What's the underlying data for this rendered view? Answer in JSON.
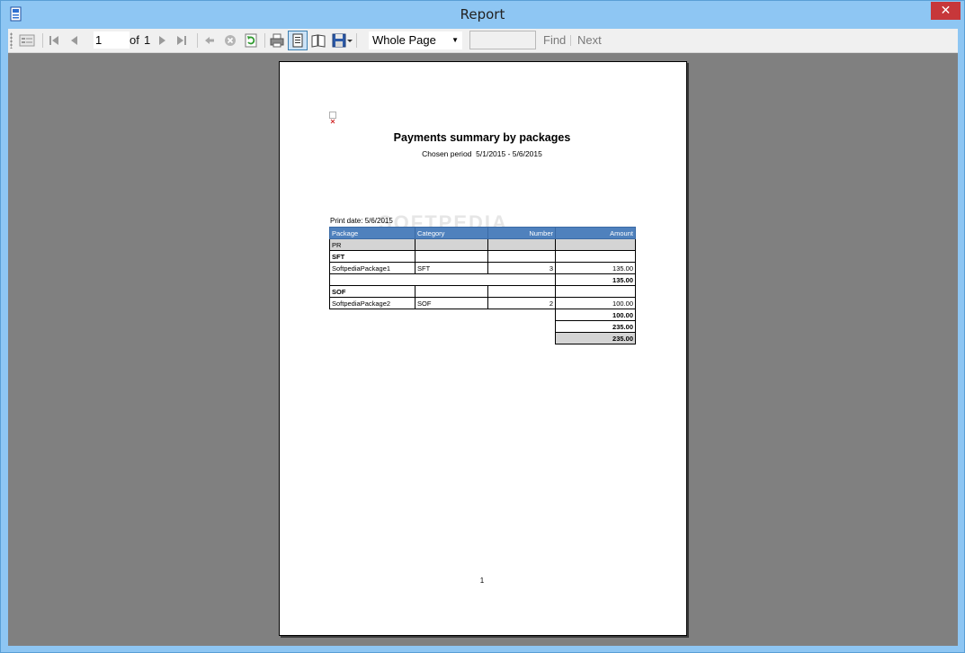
{
  "window": {
    "title": "Report",
    "close_glyph": "✕",
    "app_icon": "report-app-icon"
  },
  "toolbar": {
    "page_current": "1",
    "page_of_label": "of",
    "page_total": "1",
    "zoom_value": "Whole Page",
    "find_value": "",
    "find_label": "Find",
    "next_label": "Next",
    "icons": [
      "parameters-icon",
      "first-page-icon",
      "previous-page-icon",
      "next-page-icon",
      "last-page-icon",
      "back-icon",
      "stop-icon",
      "refresh-icon",
      "print-icon",
      "print-layout-icon",
      "page-setup-icon",
      "save-icon",
      "dropdown-arrow-icon"
    ]
  },
  "report": {
    "title": "Payments summary by packages",
    "period_label": "Chosen period",
    "period_value": "5/1/2015 - 5/6/2015",
    "print_date": "Print date: 5/6/2015",
    "watermark": "SOFTPEDIA",
    "header_color": "#4f81bd",
    "columns": [
      "Package",
      "Category",
      "Number",
      "Amount"
    ],
    "rows": [
      {
        "type": "group",
        "cells": [
          "PR",
          "",
          "",
          ""
        ]
      },
      {
        "type": "subgroup",
        "cells": [
          "SFT",
          "",
          "",
          ""
        ]
      },
      {
        "type": "detail",
        "cells": [
          "SoftpediaPackage1",
          "SFT",
          "3",
          "135.00"
        ]
      },
      {
        "type": "subtotal",
        "cells": [
          "",
          "",
          "",
          "135.00"
        ]
      },
      {
        "type": "subgroup",
        "cells": [
          "SOF",
          "",
          "",
          ""
        ]
      },
      {
        "type": "detail",
        "cells": [
          "SoftpediaPackage2",
          "SOF",
          "2",
          "100.00"
        ]
      },
      {
        "type": "subtotal",
        "cells": [
          "",
          "",
          "",
          "100.00"
        ]
      },
      {
        "type": "total",
        "cells": [
          "",
          "",
          "",
          "235.00"
        ]
      },
      {
        "type": "grandtotal",
        "cells": [
          "",
          "",
          "",
          "235.00"
        ]
      }
    ],
    "page_number": "1"
  }
}
